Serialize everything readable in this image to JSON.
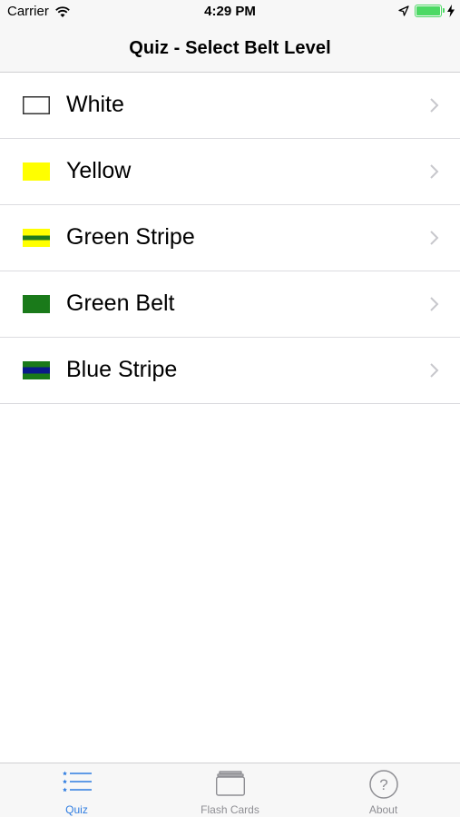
{
  "status_bar": {
    "carrier": "Carrier",
    "time": "4:29 PM",
    "battery_level": 1.0
  },
  "nav": {
    "title": "Quiz - Select Belt Level"
  },
  "belts": [
    {
      "label": "White",
      "swatch": "white",
      "colors": [
        "#ffffff"
      ],
      "border": "#333333"
    },
    {
      "label": "Yellow",
      "swatch": "yellow",
      "colors": [
        "#ffff00"
      ]
    },
    {
      "label": "Green Stripe",
      "swatch": "green-stripe",
      "colors": [
        "#ffff00",
        "#1e7a1e"
      ]
    },
    {
      "label": "Green Belt",
      "swatch": "green",
      "colors": [
        "#1a7a1a"
      ]
    },
    {
      "label": "Blue Stripe",
      "swatch": "blue-stripe",
      "colors": [
        "#1a7a1a",
        "#0a1a8a"
      ]
    }
  ],
  "tabs": [
    {
      "label": "Quiz",
      "icon": "list-icon",
      "active": true
    },
    {
      "label": "Flash Cards",
      "icon": "cards-icon",
      "active": false
    },
    {
      "label": "About",
      "icon": "question-circle-icon",
      "active": false
    }
  ],
  "colors": {
    "accent": "#2f7de1",
    "inactive": "#8e8e93",
    "battery": "#4cd964"
  }
}
